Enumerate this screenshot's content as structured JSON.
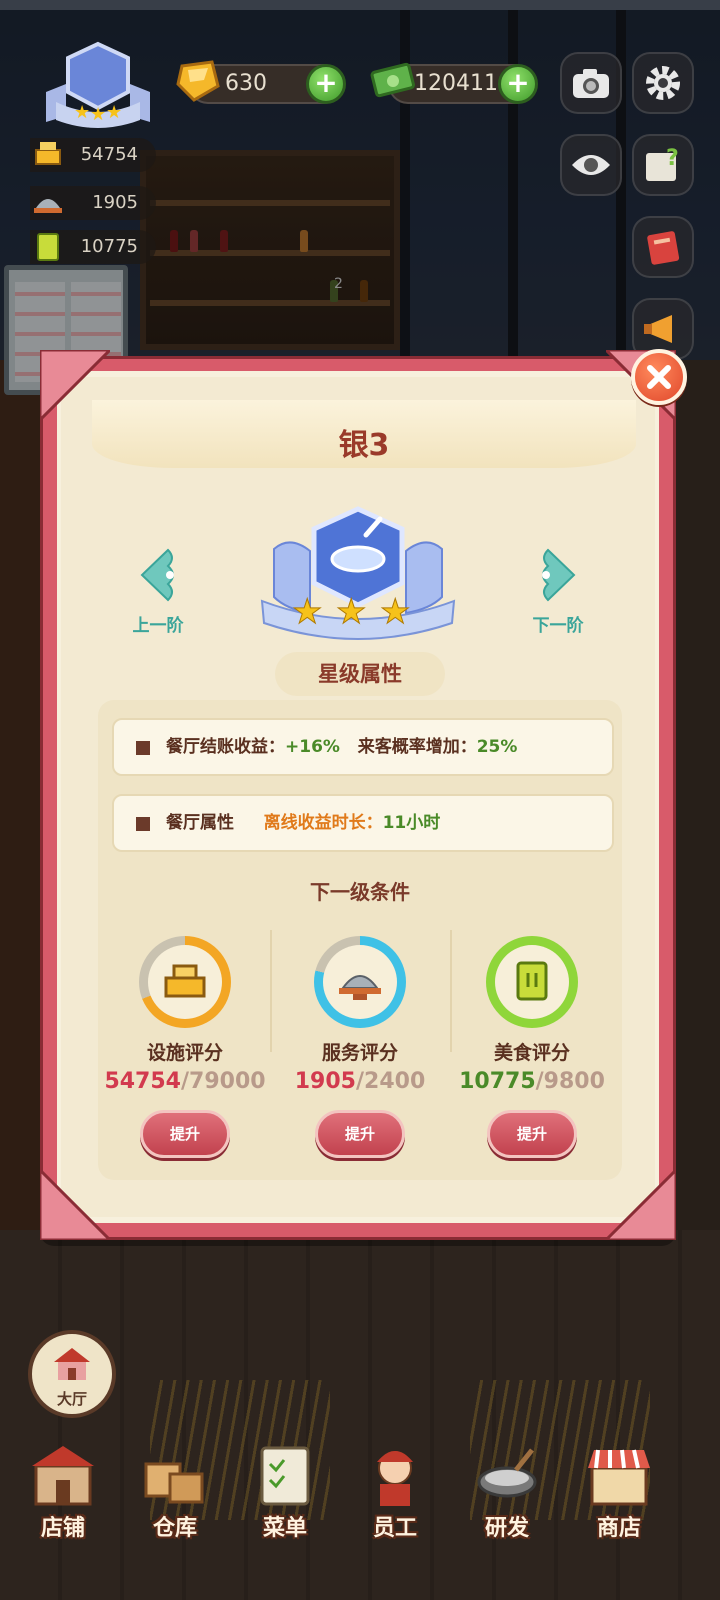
{
  "hud": {
    "gems": "630",
    "cash": "120411",
    "facility_score": "54754",
    "service_score": "1905",
    "food_score": "10775",
    "counter_badge": "2"
  },
  "modal": {
    "rank_title": "银3",
    "prev_label": "上一阶",
    "next_label": "下一阶",
    "section_title": "星级属性",
    "attr1": {
      "label": "餐厅结账收益：",
      "value": "+16%",
      "label2": "来客概率增加：",
      "value2": "25%"
    },
    "attr2": {
      "label": "餐厅属性",
      "label2": "离线收益时长：",
      "value2": "11小时"
    },
    "next_title": "下一级条件",
    "requirements": [
      {
        "label": "设施评分",
        "current": "54754",
        "target": "/79000",
        "button": "提升",
        "ring_color": "#f3a624",
        "met": false
      },
      {
        "label": "服务评分",
        "current": "1905",
        "target": "/2400",
        "button": "提升",
        "ring_color": "#3fc1e6",
        "met": false
      },
      {
        "label": "美食评分",
        "current": "10775",
        "target": "/9800",
        "button": "提升",
        "ring_color": "#8fd63a",
        "met": true
      }
    ],
    "stars": 3
  },
  "bottom_nav": {
    "hall": "大厅",
    "items": [
      "店铺",
      "仓库",
      "菜单",
      "员工",
      "研发",
      "商店"
    ]
  },
  "colors": {
    "modal_frame": "#d85b6a",
    "parchment": "#f7f0dd",
    "title_red": "#9a3a2a",
    "progress_red": "#d23a4e",
    "progress_green": "#4a8a28",
    "button_red": "#c2424e",
    "nav_teal": "#3aa59a"
  }
}
